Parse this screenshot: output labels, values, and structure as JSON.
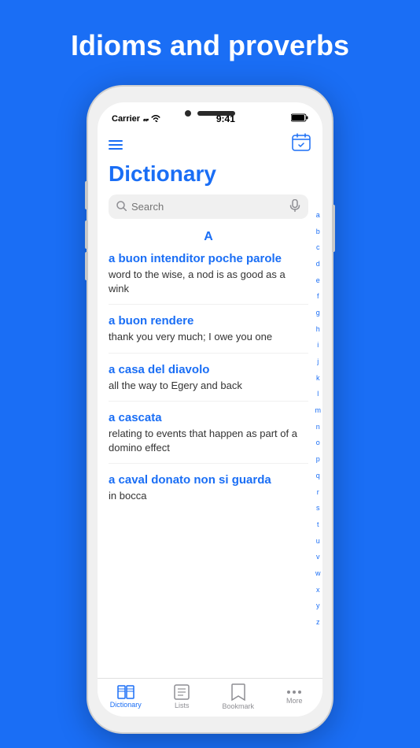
{
  "page": {
    "bg_color": "#1a6ef5",
    "title": "Idioms and proverbs"
  },
  "status_bar": {
    "carrier": "Carrier",
    "time": "9:41",
    "battery": "▓▓▓"
  },
  "header": {
    "dict_title": "Dictionary"
  },
  "search": {
    "placeholder": "Search"
  },
  "section": {
    "letter": "A"
  },
  "entries": [
    {
      "phrase": "a buon intenditor poche parole",
      "definition": "word to the wise, a nod is as good as a wink"
    },
    {
      "phrase": "a buon rendere",
      "definition": "thank you very much; I owe you one"
    },
    {
      "phrase": "a casa del diavolo",
      "definition": "all the way to Egery and back"
    },
    {
      "phrase": "a cascata",
      "definition": "relating to events that happen as part of a domino effect"
    },
    {
      "phrase": "a caval donato non si guarda",
      "definition": "in bocca"
    }
  ],
  "alphabet": [
    "a",
    "b",
    "c",
    "d",
    "e",
    "f",
    "g",
    "h",
    "i",
    "j",
    "k",
    "l",
    "m",
    "n",
    "o",
    "p",
    "q",
    "r",
    "s",
    "t",
    "u",
    "v",
    "w",
    "x",
    "y",
    "z"
  ],
  "tabs": [
    {
      "id": "dictionary",
      "label": "Dictionary",
      "icon": "📖",
      "active": true
    },
    {
      "id": "lists",
      "label": "Lists",
      "icon": "📋",
      "active": false
    },
    {
      "id": "bookmark",
      "label": "Bookmark",
      "icon": "🔖",
      "active": false
    },
    {
      "id": "more",
      "label": "More",
      "icon": "•••",
      "active": false
    }
  ],
  "calendar_icon_label": "📅"
}
